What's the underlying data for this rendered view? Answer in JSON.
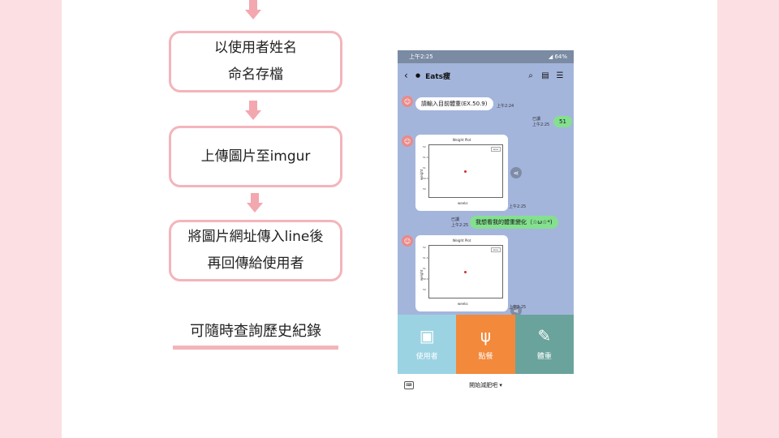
{
  "flow": {
    "box1": [
      "以使用者姓名",
      "命名存檔"
    ],
    "box2": [
      "上傳圖片至imgur"
    ],
    "box3": [
      "將圖片網址傳入line後",
      "再回傳給使用者"
    ],
    "history": "可隨時查詢歷史紀錄"
  },
  "phone": {
    "status": {
      "time": "上午2:25",
      "battery": "64%"
    },
    "header": {
      "title": "Eats瘦"
    },
    "messages": {
      "m1": {
        "text": "請輸入目前體重(EX.50.9)",
        "time": "上午2:24"
      },
      "m2": {
        "text": "51",
        "read": "已讀",
        "time": "上午2:25"
      },
      "m3": {
        "time": "上午2:25"
      },
      "m4": {
        "text": "我想看我的體重變化（☆ω☆*)",
        "read": "已讀",
        "time": "上午2:25"
      },
      "m5": {
        "time": "上午2:25"
      }
    },
    "plot": {
      "title": "Weight Plot",
      "xlabel": "weeks",
      "ylabel": "weight",
      "legend": "Line",
      "yticks": [
        "52",
        "51.5",
        "51",
        "50.5",
        "50",
        "49.5"
      ]
    },
    "menu": {
      "user": "使用者",
      "order": "點餐",
      "weight": "體重"
    },
    "bottom": {
      "switch": "開始減肥吧 ▾"
    },
    "colors": {
      "chat_bg": "#a4b5dc",
      "menu_user": "#9bd3e3",
      "menu_order": "#f3893b",
      "menu_weight": "#6aa39c"
    }
  },
  "chart_data": [
    {
      "type": "scatter",
      "title": "Weight Plot",
      "xlabel": "weeks",
      "ylabel": "weight",
      "series": [
        {
          "name": "Line",
          "x": [
            0
          ],
          "y": [
            51
          ]
        }
      ],
      "ylim": [
        49.5,
        52
      ]
    }
  ]
}
